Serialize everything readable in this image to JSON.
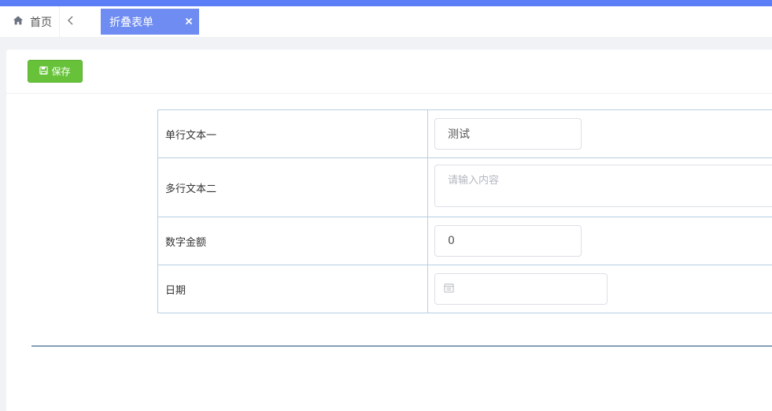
{
  "tabbar": {
    "home_label": "首页",
    "active_tab_label": "折叠表单"
  },
  "toolbar": {
    "save_label": "保存"
  },
  "form": {
    "rows": [
      {
        "label": "单行文本一",
        "value": "测试"
      },
      {
        "label": "多行文本二",
        "placeholder": "请输入内容",
        "value": ""
      },
      {
        "label": "数字金额",
        "value": "0"
      },
      {
        "label": "日期",
        "value": ""
      }
    ]
  },
  "colors": {
    "top_accent": "#5b7df5",
    "active_tab": "#6f8cf2",
    "save_button": "#67c23a",
    "table_border": "#b9cfe0",
    "divider": "#1f4e79"
  },
  "icons": {
    "home": "home-icon",
    "back": "chevron-left-icon",
    "close": "close-icon",
    "save": "save-icon",
    "date": "calendar-icon"
  }
}
